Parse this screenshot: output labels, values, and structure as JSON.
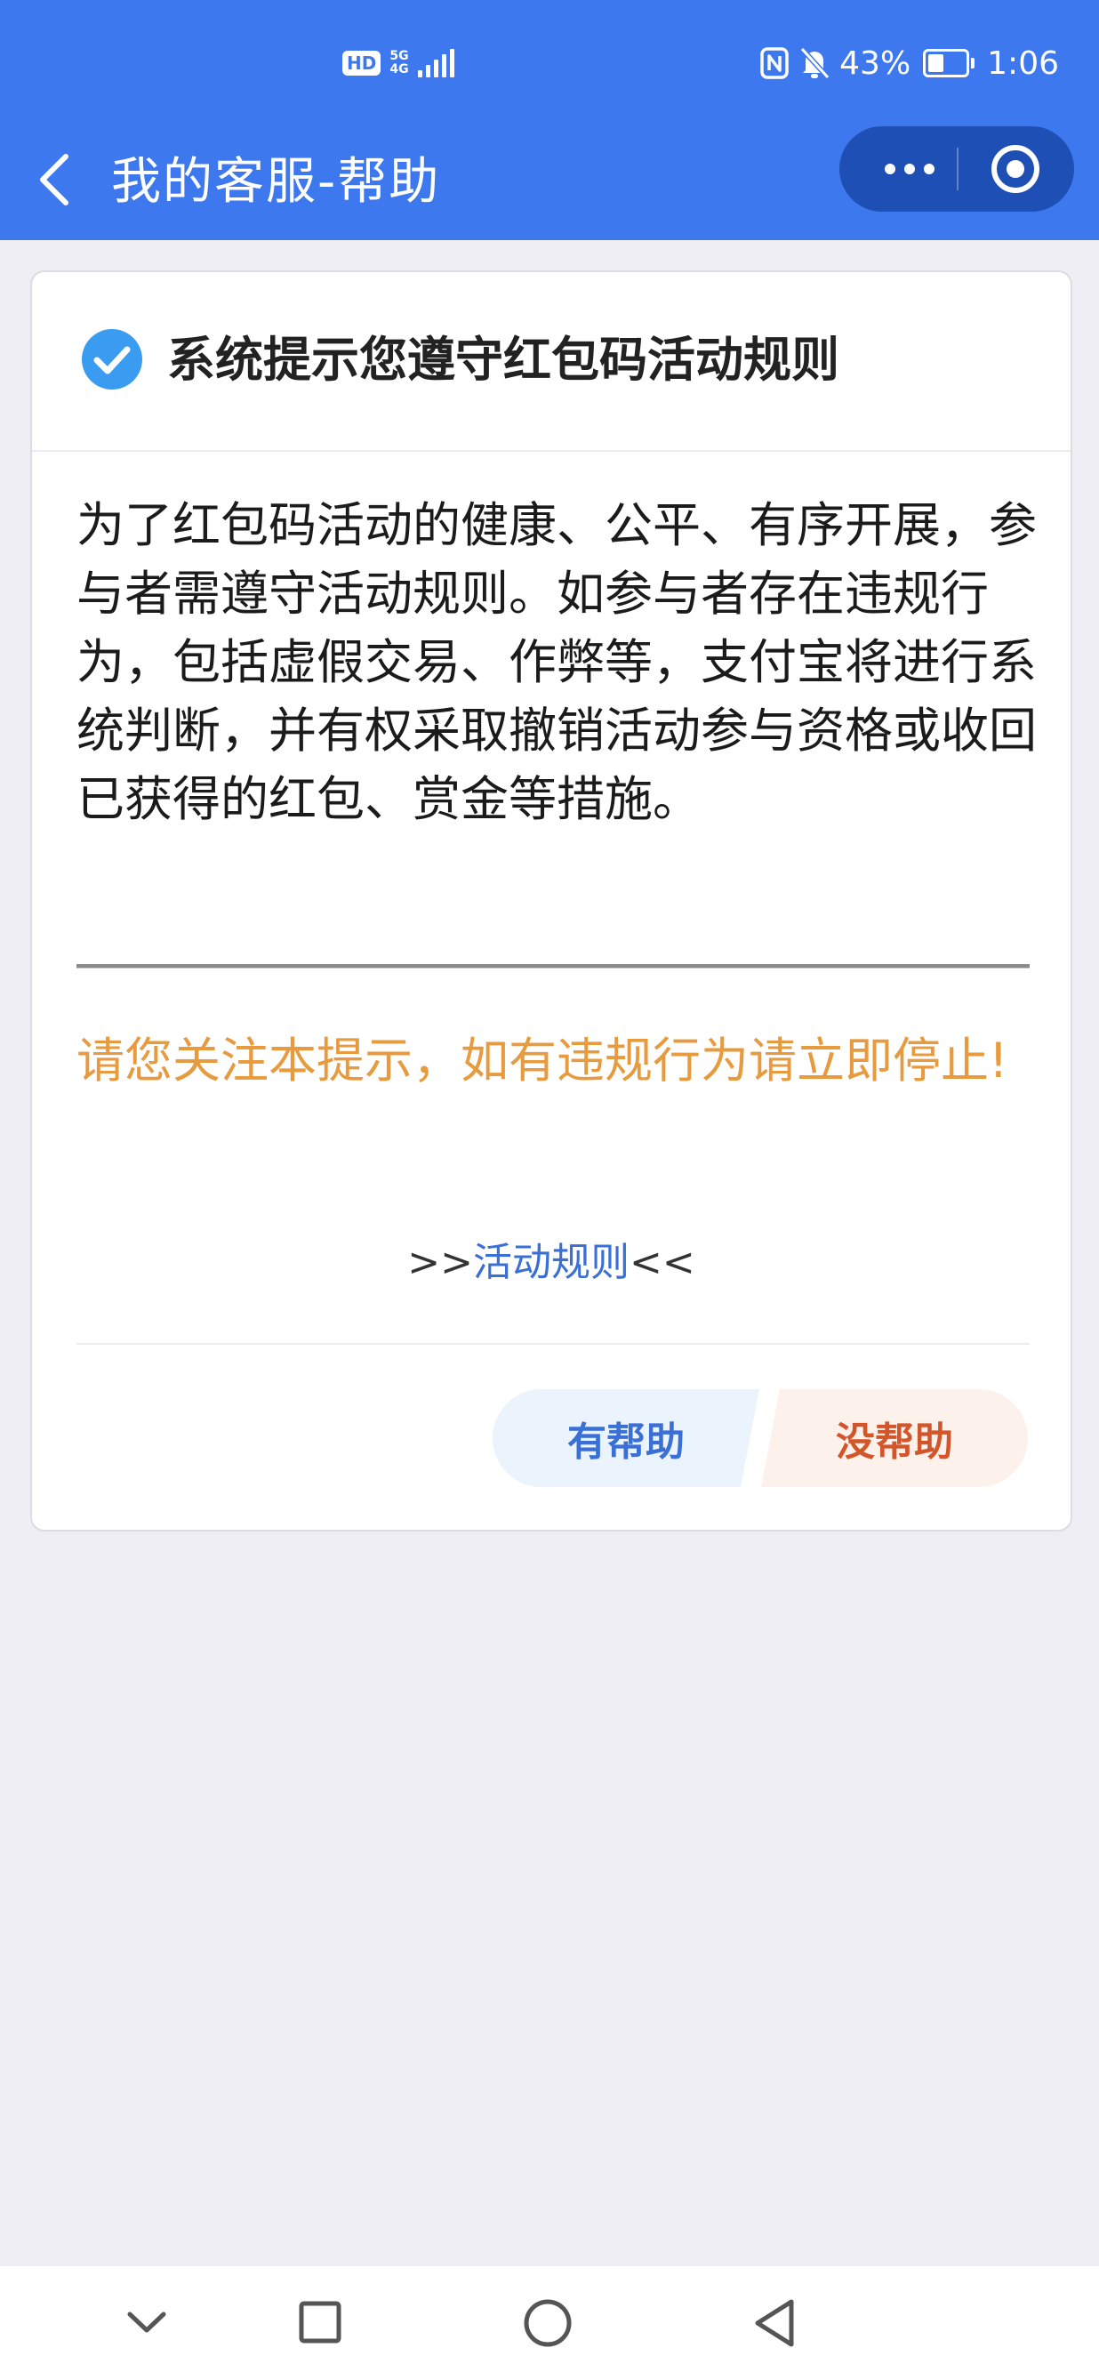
{
  "status_bar": {
    "hd": "HD",
    "network_top": "5G",
    "network_bottom": "4G",
    "battery_percent": "43%",
    "battery_level": 0.43,
    "time": "1:06"
  },
  "nav": {
    "title": "我的客服-帮助"
  },
  "card": {
    "title": "系统提示您遵守红包码活动规则",
    "body": "为了红包码活动的健康、公平、有序开展，参与者需遵守活动规则。如参与者存在违规行为，包括虚假交易、作弊等，支付宝将进行系统判断，并有权采取撤销活动参与资格或收回已获得的红包、赏金等措施。",
    "warning": "请您关注本提示，如有违规行为请立即停止!",
    "link_prefix": ">>",
    "link_label": "活动规则",
    "link_suffix": "<<",
    "helpful_label": "有帮助",
    "not_helpful_label": "没帮助"
  },
  "colors": {
    "header": "#3d78ef",
    "capsule": "#1e4fb4",
    "warning": "#e79a3e",
    "link": "#3a6fd6",
    "not_helpful": "#d3552a",
    "check": "#3a9cf0"
  },
  "icons": [
    "back-arrow-icon",
    "more-icon",
    "close-target-icon",
    "check-circle-icon",
    "chevron-down-icon",
    "square-icon",
    "circle-home-icon",
    "triangle-back-icon"
  ]
}
